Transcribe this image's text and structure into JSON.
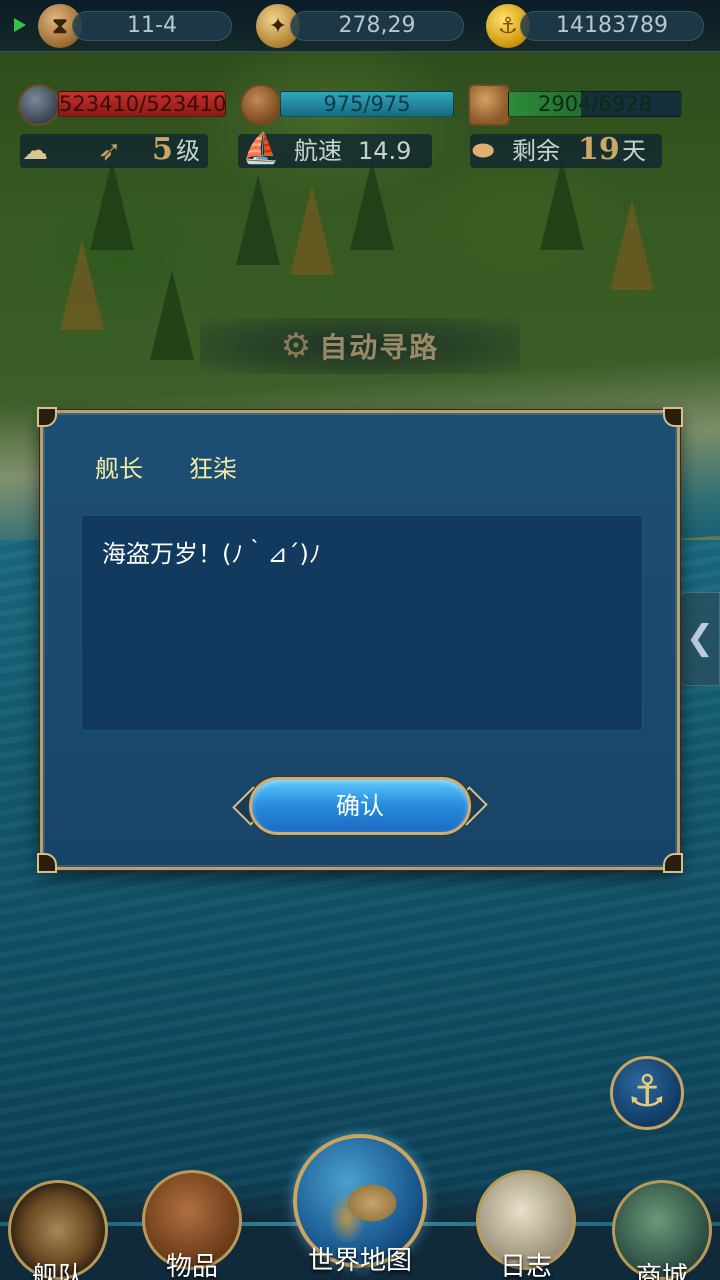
{
  "topbar": {
    "level_stage": "11-4",
    "coordinates": "278,29",
    "gold": "14183789"
  },
  "stats": {
    "durability": "523410/523410",
    "crew": "975/975",
    "cargo": "2904/6928",
    "cargo_fill_fraction": 0.42
  },
  "info": {
    "level_number": "5",
    "level_unit": "级",
    "speed_label": "航速",
    "speed_value": "14.9",
    "remaining_label": "剩余",
    "remaining_days": "19",
    "remaining_unit": "天"
  },
  "auto_path": {
    "label": "自动寻路"
  },
  "dialog": {
    "speaker_role": "舰长",
    "speaker_name": "狂柒",
    "message": "海盗万岁！(ﾉ｀⊿´)ﾉ",
    "confirm_label": "确认"
  },
  "side_tab": {
    "glyph": "❮"
  },
  "anchor": {
    "glyph": "⚓"
  },
  "nav": {
    "fleet": "舰队",
    "items": "物品",
    "world_map": "世界地图",
    "log": "日志",
    "shop": "商城"
  },
  "colors": {
    "dialog_bg": "#1d4f74",
    "dialog_border": "#b8a070",
    "confirm_button": "#2a8fe0",
    "speaker_text": "#f3e9a8"
  }
}
